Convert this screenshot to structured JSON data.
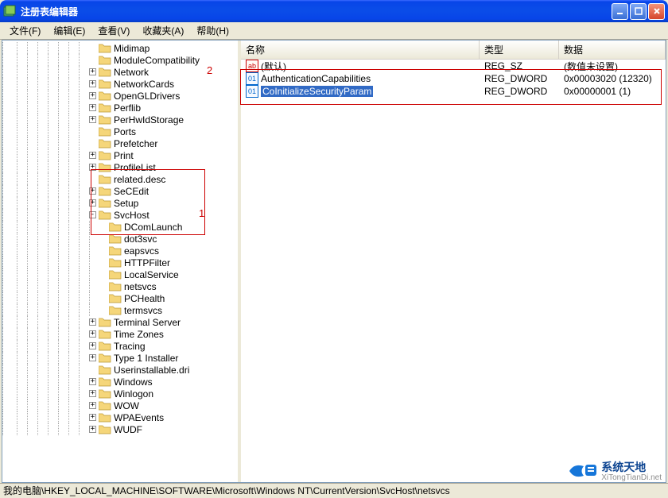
{
  "title": "注册表编辑器",
  "menu": {
    "file": "文件(F)",
    "edit": "编辑(E)",
    "view": "查看(V)",
    "favorites": "收藏夹(A)",
    "help": "帮助(H)"
  },
  "tree": {
    "items": [
      {
        "indent": 8,
        "expand": "",
        "label": "Midimap"
      },
      {
        "indent": 8,
        "expand": "",
        "label": "ModuleCompatibility"
      },
      {
        "indent": 8,
        "expand": "+",
        "label": "Network"
      },
      {
        "indent": 8,
        "expand": "+",
        "label": "NetworkCards"
      },
      {
        "indent": 8,
        "expand": "+",
        "label": "OpenGLDrivers"
      },
      {
        "indent": 8,
        "expand": "+",
        "label": "Perflib"
      },
      {
        "indent": 8,
        "expand": "+",
        "label": "PerHwIdStorage"
      },
      {
        "indent": 8,
        "expand": "",
        "label": "Ports"
      },
      {
        "indent": 8,
        "expand": "",
        "label": "Prefetcher"
      },
      {
        "indent": 8,
        "expand": "+",
        "label": "Print"
      },
      {
        "indent": 8,
        "expand": "+",
        "label": "ProfileList"
      },
      {
        "indent": 8,
        "expand": "",
        "label": "related.desc"
      },
      {
        "indent": 8,
        "expand": "+",
        "label": "SeCEdit"
      },
      {
        "indent": 8,
        "expand": "+",
        "label": "Setup"
      },
      {
        "indent": 8,
        "expand": "-",
        "label": "SvcHost"
      },
      {
        "indent": 9,
        "expand": "",
        "label": "DComLaunch"
      },
      {
        "indent": 9,
        "expand": "",
        "label": "dot3svc"
      },
      {
        "indent": 9,
        "expand": "",
        "label": "eapsvcs"
      },
      {
        "indent": 9,
        "expand": "",
        "label": "HTTPFilter"
      },
      {
        "indent": 9,
        "expand": "",
        "label": "LocalService"
      },
      {
        "indent": 9,
        "expand": "",
        "label": "netsvcs"
      },
      {
        "indent": 9,
        "expand": "",
        "label": "PCHealth"
      },
      {
        "indent": 9,
        "expand": "",
        "label": "termsvcs"
      },
      {
        "indent": 8,
        "expand": "+",
        "label": "Terminal Server"
      },
      {
        "indent": 8,
        "expand": "+",
        "label": "Time Zones"
      },
      {
        "indent": 8,
        "expand": "+",
        "label": "Tracing"
      },
      {
        "indent": 8,
        "expand": "+",
        "label": "Type 1 Installer"
      },
      {
        "indent": 8,
        "expand": "",
        "label": "Userinstallable.dri"
      },
      {
        "indent": 8,
        "expand": "+",
        "label": "Windows"
      },
      {
        "indent": 8,
        "expand": "+",
        "label": "Winlogon"
      },
      {
        "indent": 8,
        "expand": "+",
        "label": "WOW"
      },
      {
        "indent": 8,
        "expand": "+",
        "label": "WPAEvents"
      },
      {
        "indent": 8,
        "expand": "+",
        "label": "WUDF"
      }
    ]
  },
  "list": {
    "headers": {
      "name": "名称",
      "type": "类型",
      "data": "数据"
    },
    "rows": [
      {
        "icon": "sz",
        "iconText": "ab",
        "name": "(默认)",
        "type": "REG_SZ",
        "data": "(数值未设置)",
        "selected": false
      },
      {
        "icon": "dw",
        "iconText": "01",
        "name": "AuthenticationCapabilities",
        "type": "REG_DWORD",
        "data": "0x00003020 (12320)",
        "selected": false
      },
      {
        "icon": "dw",
        "iconText": "01",
        "name": "CoInitializeSecurityParam",
        "type": "REG_DWORD",
        "data": "0x00000001 (1)",
        "selected": true
      }
    ]
  },
  "annotations": {
    "num1": "1",
    "num2": "2"
  },
  "status": "我的电脑\\HKEY_LOCAL_MACHINE\\SOFTWARE\\Microsoft\\Windows NT\\CurrentVersion\\SvcHost\\netsvcs",
  "watermark": {
    "text": "系统天地",
    "sub": "XiTongTianDi.net"
  }
}
